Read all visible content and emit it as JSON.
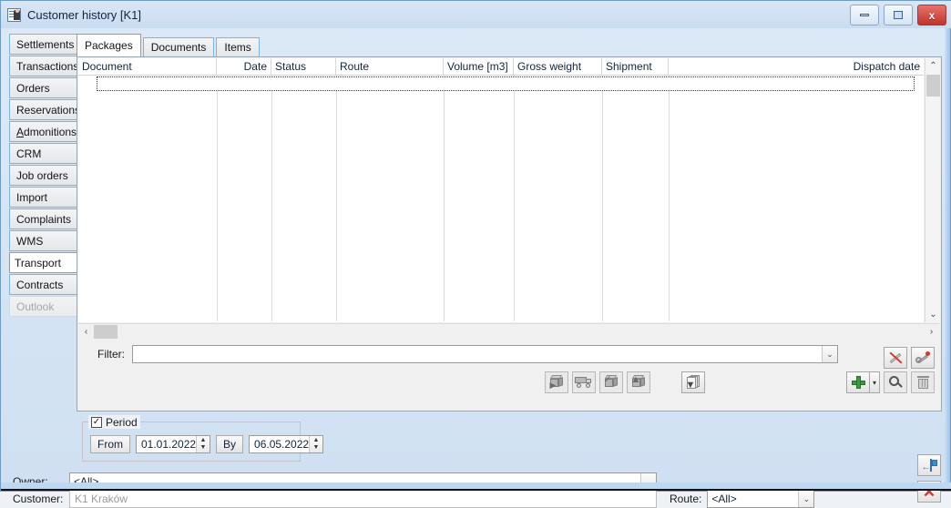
{
  "window": {
    "title": "Customer history [K1]",
    "title_icon": "customer-card-icon",
    "minimize_label": "",
    "maximize_label": "",
    "close_label": "x"
  },
  "sidebar": {
    "items": [
      {
        "label": "Settlements",
        "state": "normal"
      },
      {
        "label": "Transactions",
        "state": "normal"
      },
      {
        "label": "Orders",
        "state": "normal"
      },
      {
        "label": "Reservations",
        "state": "normal"
      },
      {
        "label": "Admonitions",
        "state": "normal",
        "accel": "A"
      },
      {
        "label": "CRM",
        "state": "normal"
      },
      {
        "label": "Job orders",
        "state": "normal"
      },
      {
        "label": "Import",
        "state": "normal"
      },
      {
        "label": "Complaints",
        "state": "normal"
      },
      {
        "label": "WMS",
        "state": "normal"
      },
      {
        "label": "Transport",
        "state": "selected"
      },
      {
        "label": "Contracts",
        "state": "normal"
      },
      {
        "label": "Outlook",
        "state": "disabled"
      }
    ]
  },
  "tabs": [
    {
      "label": "Packages",
      "active": true
    },
    {
      "label": "Documents",
      "active": false
    },
    {
      "label": "Items",
      "active": false
    }
  ],
  "grid": {
    "columns": [
      {
        "label": "Document",
        "align": "left"
      },
      {
        "label": "Date",
        "align": "right"
      },
      {
        "label": "Status",
        "align": "left"
      },
      {
        "label": "Route",
        "align": "left"
      },
      {
        "label": "Volume [m3]",
        "align": "left"
      },
      {
        "label": "Gross weight",
        "align": "left"
      },
      {
        "label": "Shipment",
        "align": "left"
      },
      {
        "label": "Dispatch date",
        "align": "right"
      }
    ],
    "rows": []
  },
  "scrollbars": {
    "vertical_up": "⌃",
    "vertical_down": "⌄",
    "horizontal_left": "‹",
    "horizontal_right": "›"
  },
  "filter": {
    "label": "Filter:",
    "value": "",
    "placeholder": ""
  },
  "toolbar": {
    "left_buttons": [
      {
        "name": "package-dispatch-icon",
        "enabled": false
      },
      {
        "name": "truck-delivery-icon",
        "enabled": false
      },
      {
        "name": "package-check-icon",
        "enabled": false
      },
      {
        "name": "package-unload-icon",
        "enabled": false
      }
    ],
    "mid_button": {
      "name": "copy-pages-icon",
      "enabled": true
    },
    "clear_filter_button": {
      "name": "clear-filter-icon"
    },
    "settings_button": {
      "name": "wrench-settings-icon"
    },
    "add_button": {
      "name": "add-plus-icon"
    },
    "add_dropdown": {
      "name": "chevron-down-icon",
      "glyph": "▾"
    },
    "search_button": {
      "name": "magnifier-icon"
    },
    "delete_button": {
      "name": "trash-icon",
      "enabled": false
    }
  },
  "period": {
    "checkbox_label": "Period",
    "checked": true,
    "check_glyph": "✓",
    "from_label": "From",
    "from_value": "01.01.2022",
    "by_label": "By",
    "by_value": "06.05.2022",
    "spin_up": "▲",
    "spin_down": "▼"
  },
  "fields": {
    "owner_label": "Owner:",
    "owner_value": "<All>",
    "customer_label": "Customer:",
    "customer_value": "K1 Kraków",
    "route_label": "Route:",
    "route_value": "<All>",
    "combo_arrow": "⌄"
  },
  "actions": {
    "apply_button": {
      "name": "blue-flag-icon"
    },
    "close_button": {
      "name": "red-x-icon",
      "glyph": "✕"
    }
  },
  "colors": {
    "title_bar": "#d9e7f6",
    "window_border": "#6f9bc7",
    "tab_border": "#76b5e0",
    "accent_green": "#3e9b3e",
    "accent_red": "#d9342a",
    "accent_blue": "#3a8fd0",
    "background": "#eef1f5",
    "disabled_text": "#a7a7a7"
  }
}
